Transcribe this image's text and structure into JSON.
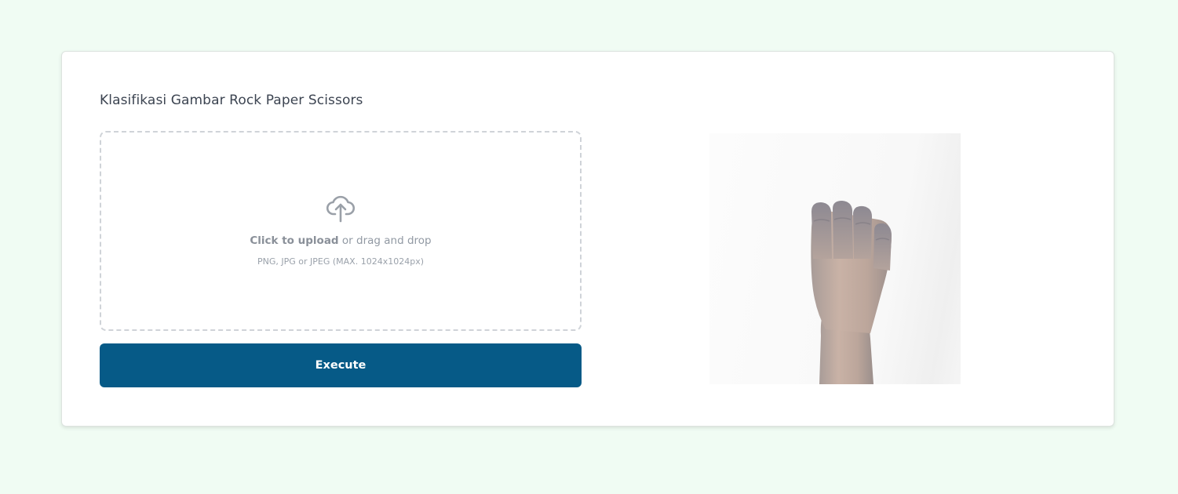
{
  "card": {
    "title": "Klasifikasi Gambar Rock Paper Scissors"
  },
  "upload": {
    "icon": "cloud-upload-icon",
    "click_label": "Click to upload",
    "drag_label": " or drag and drop",
    "hint": "PNG, JPG or JPEG (MAX. 1024x1024px)"
  },
  "execute_button": {
    "label": "Execute"
  },
  "preview": {
    "alt": "uploaded hand image (rock gesture)"
  },
  "colors": {
    "page_background": "#f0fcf3",
    "button": "#065a87"
  }
}
